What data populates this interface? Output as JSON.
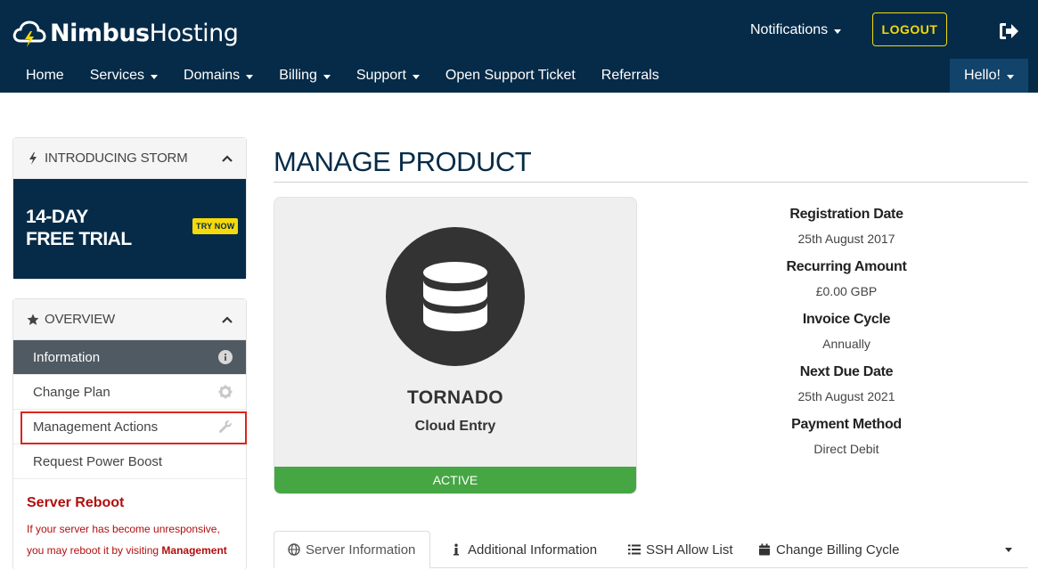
{
  "header": {
    "logo_bold": "Nimbus",
    "logo_regular": "Hosting",
    "notifications_label": "Notifications",
    "logout_label": "LOGOUT",
    "nav": [
      "Home",
      "Services",
      "Domains",
      "Billing",
      "Support",
      "Open Support Ticket",
      "Referrals"
    ],
    "hello_label": "Hello!"
  },
  "sidebar": {
    "promo_panel_title": "Introducing Storm",
    "promo_line1": "14-DAY",
    "promo_line2": "FREE TRIAL",
    "promo_button": "TRY NOW",
    "overview_title": "Overview",
    "items": [
      {
        "label": "Information"
      },
      {
        "label": "Change Plan"
      },
      {
        "label": "Management Actions"
      },
      {
        "label": "Request Power Boost"
      }
    ],
    "reboot_title": "Server Reboot",
    "reboot_text_1": "If your server has become unresponsive,",
    "reboot_text_2": "you may reboot it by visiting",
    "reboot_text_link": "Management"
  },
  "main": {
    "page_title": "MANAGE PRODUCT",
    "product_name": "TORNADO",
    "product_plan": "Cloud Entry",
    "status": "ACTIVE",
    "details": [
      {
        "label": "Registration Date",
        "value": "25th August 2017"
      },
      {
        "label": "Recurring Amount",
        "value": "£0.00 GBP"
      },
      {
        "label": "Invoice Cycle",
        "value": "Annually"
      },
      {
        "label": "Next Due Date",
        "value": "25th August 2021"
      },
      {
        "label": "Payment Method",
        "value": "Direct Debit"
      }
    ],
    "tabs": [
      {
        "label": "Server Information",
        "icon": "globe-icon"
      },
      {
        "label": "Additional Information",
        "icon": "info-icon"
      },
      {
        "label": "SSH Allow List",
        "icon": "list-icon"
      },
      {
        "label": "Change Billing Cycle",
        "icon": "calendar-icon"
      }
    ]
  },
  "colors": {
    "navy": "#052b48",
    "accent_yellow": "#f5d90a",
    "active_green": "#46a644",
    "alert_red": "#b20e0e"
  }
}
